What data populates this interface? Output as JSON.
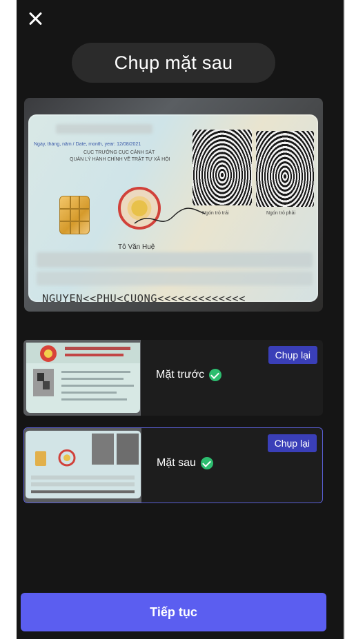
{
  "header": {
    "close_icon": "close-icon",
    "title": "Chụp mặt sau"
  },
  "card_preview": {
    "issued_date_text": "Ngày, tháng, năm / Date, month, year: 12/08/2021",
    "authority_title": "CỤC TRƯỞNG CỤC CẢNH SÁT",
    "authority_subtitle": "QUẢN LÝ HÀNH CHÍNH VỀ TRẬT TỰ XÃ HỘI",
    "signer_name": "Tô Văn Huệ",
    "left_finger_label": "Ngón trỏ trái",
    "right_finger_label": "Ngón trỏ phải",
    "mrz_line": "NGUYEN<<PHU<CUONG<<<<<<<<<<<<<"
  },
  "captures": [
    {
      "label": "Mặt trước",
      "status": "done",
      "retake_label": "Chụp lại",
      "active": false
    },
    {
      "label": "Mặt sau",
      "status": "done",
      "retake_label": "Chụp lại",
      "active": true
    }
  ],
  "footer": {
    "continue_label": "Tiếp tục"
  },
  "colors": {
    "background": "#151515",
    "primary": "#5b5ef0",
    "retake": "#3a3fb8",
    "success": "#2dbd6f"
  }
}
